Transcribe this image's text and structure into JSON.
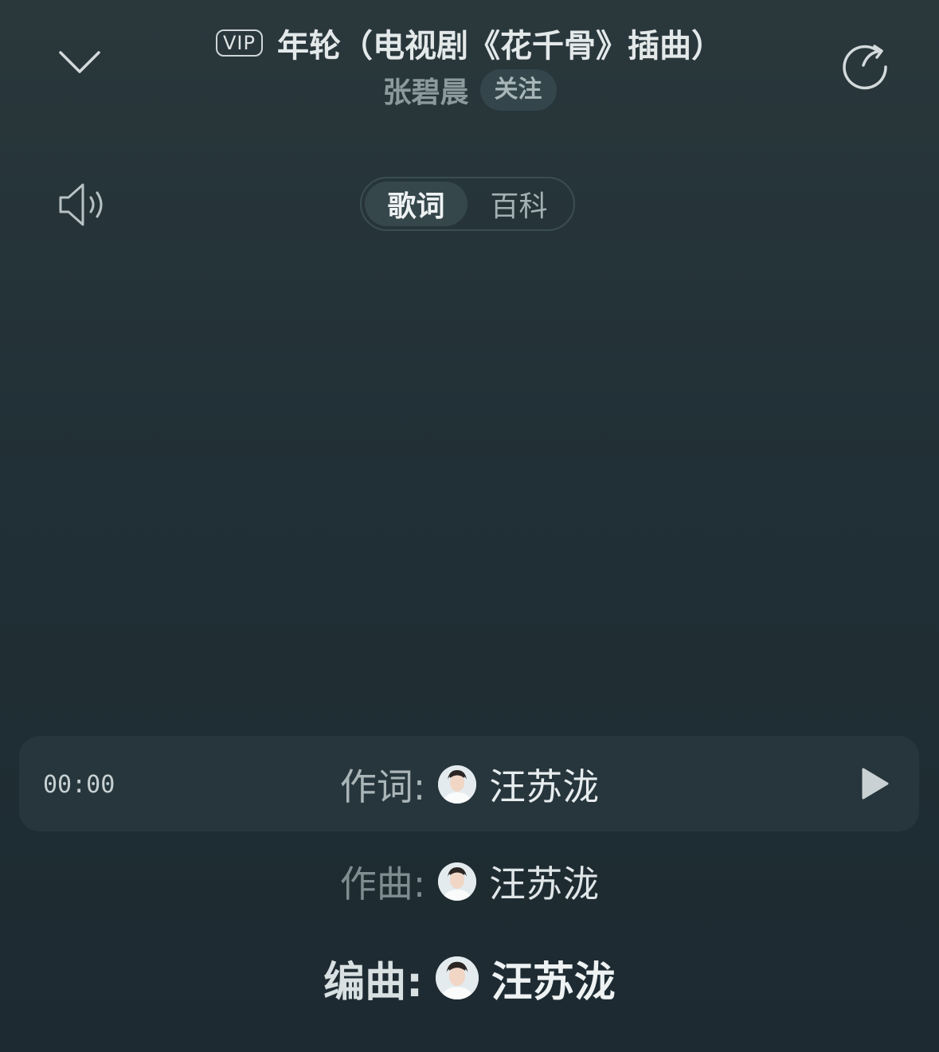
{
  "header": {
    "vip_badge": "VIP",
    "song_title": "年轮（电视剧《花千骨》插曲）",
    "artist": "张碧晨",
    "follow_label": "关注"
  },
  "tabs": [
    {
      "label": "歌词",
      "active": true
    },
    {
      "label": "百科",
      "active": false
    }
  ],
  "lyrics": {
    "current_time": "00:00",
    "lines": [
      {
        "label": "作词:",
        "name": "汪苏泷",
        "state": "current"
      },
      {
        "label": "作曲:",
        "name": "汪苏泷",
        "state": "upcoming"
      },
      {
        "label": "编曲:",
        "name": "汪苏泷",
        "state": "upcoming"
      }
    ]
  },
  "icons": {
    "collapse": "chevron-down-icon",
    "share": "share-icon",
    "volume": "volume-icon",
    "play": "play-icon"
  },
  "colors": {
    "background_top": "#2a383c",
    "background_bottom": "#1d2a31",
    "highlight_row": "#27363c",
    "active_tab": "#36474c"
  }
}
